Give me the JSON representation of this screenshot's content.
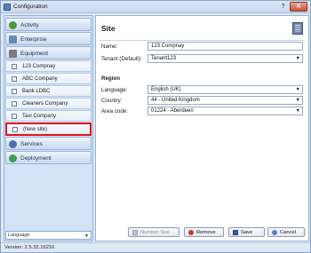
{
  "window": {
    "title": "Configuration",
    "help_glyph": "?",
    "close_glyph": "✕"
  },
  "sidebar": {
    "headers_top": [
      {
        "label": "Activity",
        "icon": "activity-icon",
        "color": "#4a9a3a"
      },
      {
        "label": "Enterprise",
        "icon": "enterprise-icon",
        "color": "#6d86b6"
      },
      {
        "label": "Equipment",
        "icon": "equipment-icon",
        "color": "#7a7a7a"
      }
    ],
    "items": [
      {
        "label": "123 Compnay"
      },
      {
        "label": "ABC Company"
      },
      {
        "label": "Bank LDBC"
      },
      {
        "label": "Cleaners Company"
      },
      {
        "label": "Taxi Company"
      },
      {
        "label": "(New site)"
      }
    ],
    "headers_bottom": [
      {
        "label": "Services",
        "icon": "services-icon",
        "color": "#4d6fb0"
      },
      {
        "label": "Deployment",
        "icon": "deployment-icon",
        "color": "#3aa04a"
      }
    ],
    "language_label": "Language"
  },
  "site": {
    "title": "Site",
    "name_label": "Name:",
    "name_value": "123 Compnay",
    "tenant_label": "Tenant (Default):",
    "tenant_value": "Tenant123",
    "region_title": "Region",
    "language_label": "Language:",
    "language_value": "English (UK)",
    "country_label": "Country:",
    "country_value": "44 - United Kingdom",
    "areacode_label": "Area code:",
    "areacode_value": "01224 - Aberdeen"
  },
  "buttons": {
    "number_test": "Number Test",
    "remove": "Remove",
    "save": "Save",
    "cancel": "Cancel"
  },
  "status": {
    "version": "Version: 2.5.32.16216"
  }
}
